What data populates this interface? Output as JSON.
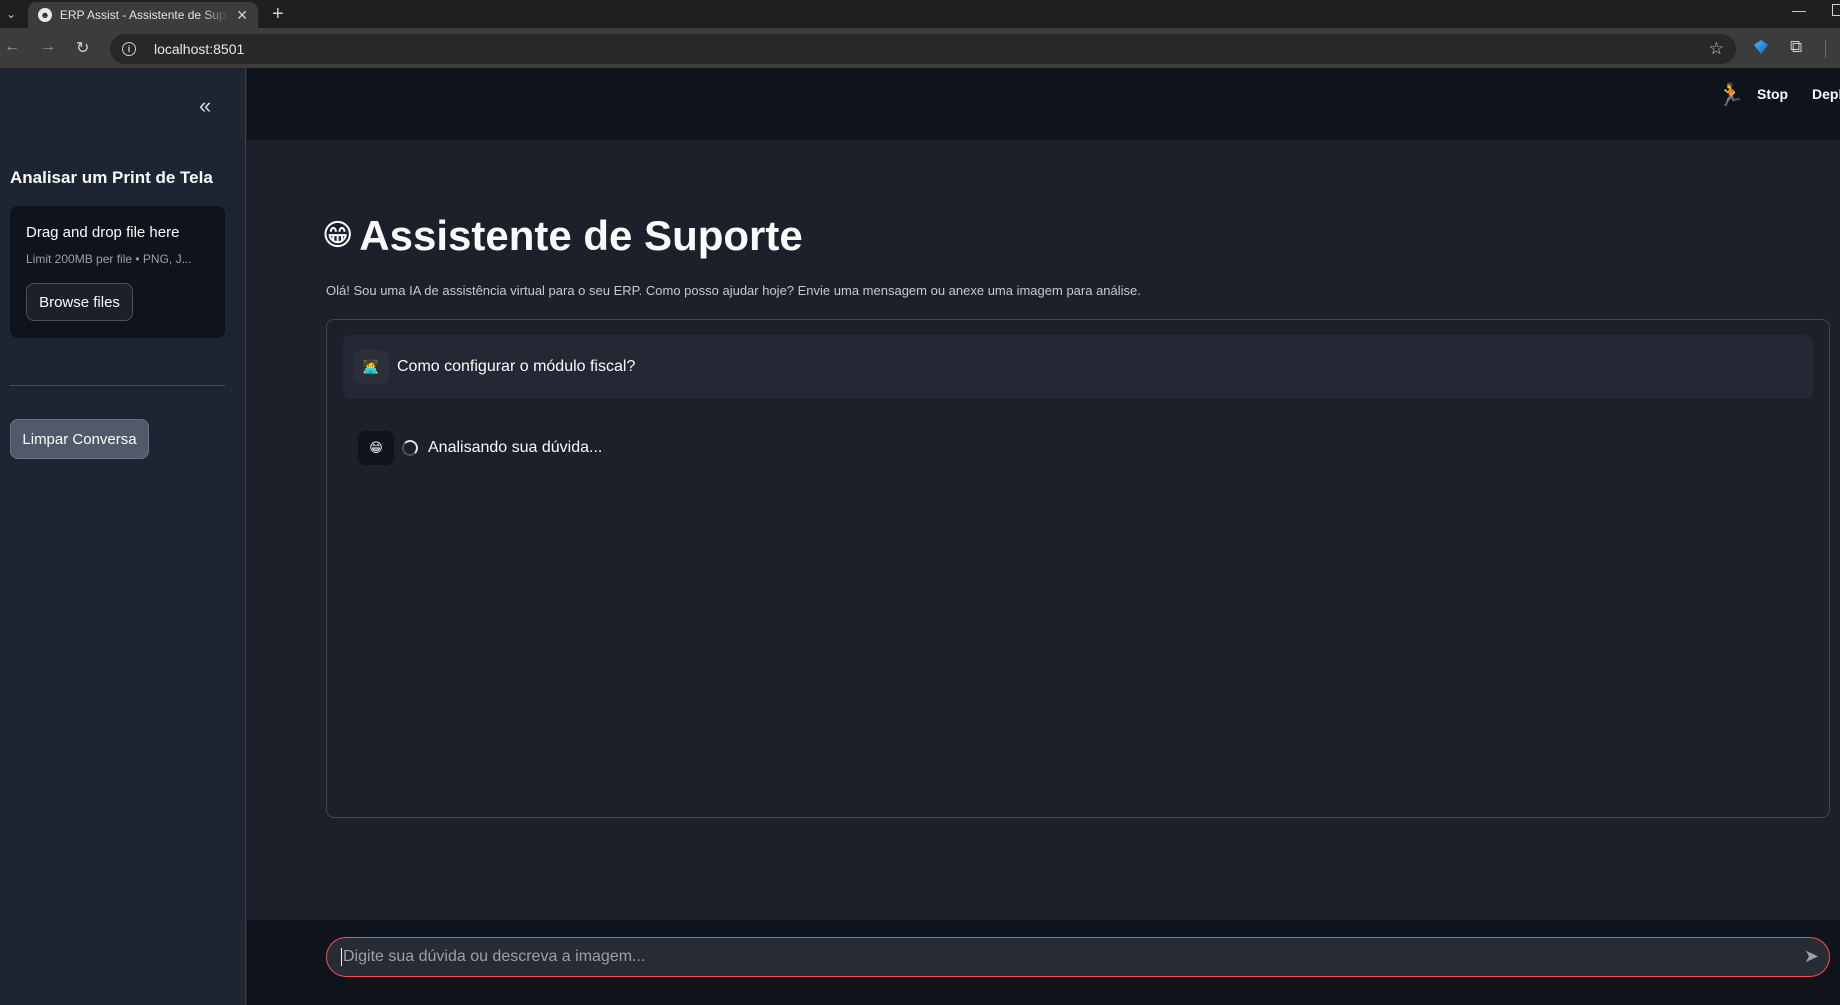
{
  "browser": {
    "tab_title": "ERP Assist - Assistente de Suporte",
    "url": "localhost:8501"
  },
  "sidebar": {
    "heading": "Analisar um Print de Tela",
    "uploader": {
      "title": "Drag and drop file here",
      "limit": "Limit 200MB per file • PNG, J...",
      "browse_label": "Browse files"
    },
    "clear_label": "Limpar Conversa"
  },
  "header": {
    "stop_label": "Stop",
    "deploy_label": "Depl"
  },
  "main": {
    "title_icon": "😁",
    "title": "Assistente de Suporte",
    "subtitle": "Olá! Sou uma IA de assistência virtual para o seu ERP. Como posso ajudar hoje? Envie uma mensagem ou anexe uma imagem para análise.",
    "messages": [
      {
        "role": "user",
        "avatar": "🧑‍💻",
        "text": "Como configurar o módulo fiscal?"
      },
      {
        "role": "assistant",
        "avatar": "😁",
        "text": "Analisando sua dúvida..."
      }
    ]
  },
  "chat_input": {
    "placeholder": "Digite sua dúvida ou descreva a imagem..."
  },
  "colors": {
    "accent": "#ff4b4b",
    "background": "#1b202b",
    "sidebar": "#1d2432"
  }
}
